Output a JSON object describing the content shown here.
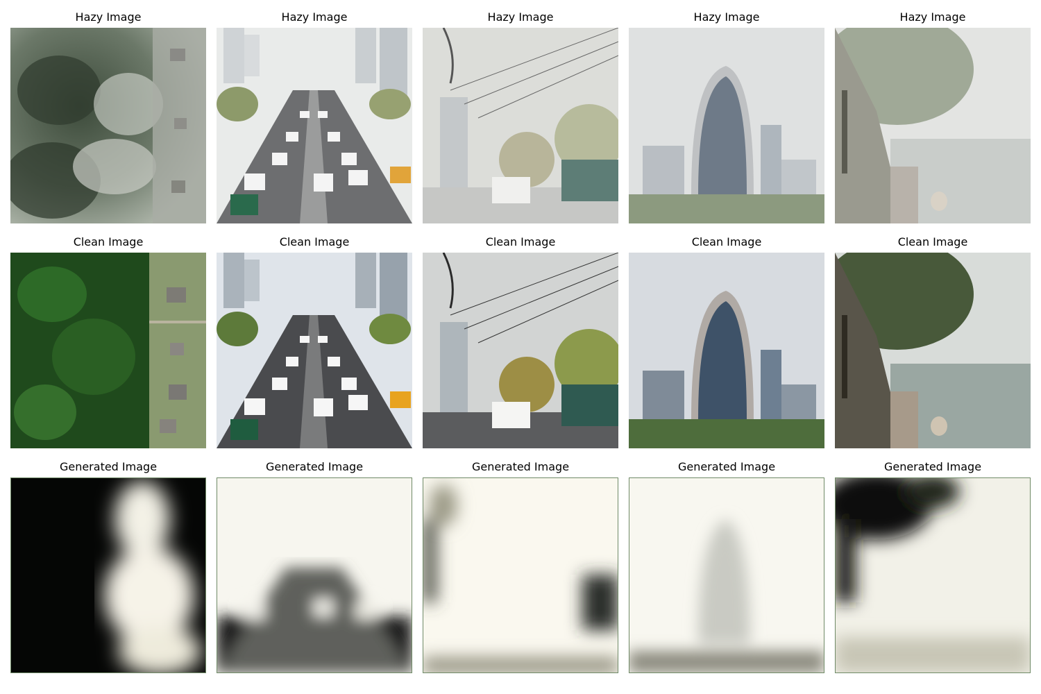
{
  "figure": {
    "rows": [
      {
        "row_label": "hazy",
        "panels": [
          {
            "title": "Hazy Image",
            "scene": "aerial-forest-houses"
          },
          {
            "title": "Hazy Image",
            "scene": "city-traffic-highway"
          },
          {
            "title": "Hazy Image",
            "scene": "street-powerlines-cars"
          },
          {
            "title": "Hazy Image",
            "scene": "arch-skyscraper-skyline"
          },
          {
            "title": "Hazy Image",
            "scene": "willow-riverbank"
          }
        ]
      },
      {
        "row_label": "clean",
        "panels": [
          {
            "title": "Clean Image",
            "scene": "aerial-forest-houses"
          },
          {
            "title": "Clean Image",
            "scene": "city-traffic-highway"
          },
          {
            "title": "Clean Image",
            "scene": "street-powerlines-cars"
          },
          {
            "title": "Clean Image",
            "scene": "arch-skyscraper-skyline"
          },
          {
            "title": "Clean Image",
            "scene": "willow-riverbank"
          }
        ]
      },
      {
        "row_label": "generated",
        "panels": [
          {
            "title": "Generated Image",
            "scene": "aerial-forest-houses"
          },
          {
            "title": "Generated Image",
            "scene": "city-traffic-highway"
          },
          {
            "title": "Generated Image",
            "scene": "street-powerlines-cars"
          },
          {
            "title": "Generated Image",
            "scene": "arch-skyscraper-skyline"
          },
          {
            "title": "Generated Image",
            "scene": "willow-riverbank"
          }
        ]
      }
    ]
  }
}
